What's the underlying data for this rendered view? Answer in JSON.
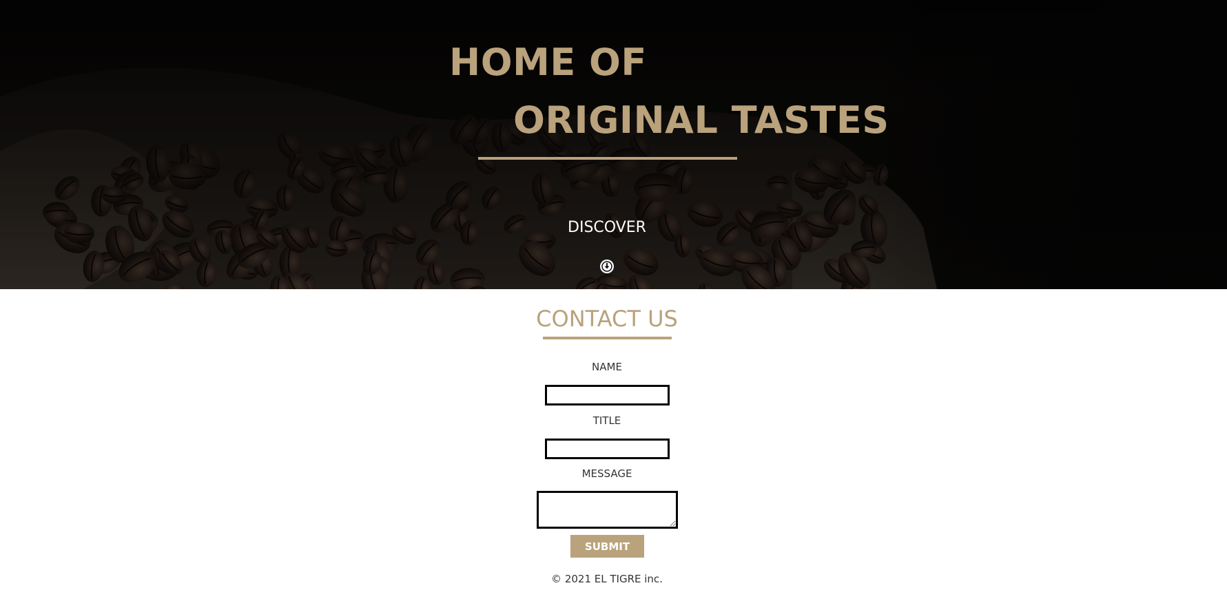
{
  "hero": {
    "title_line1": "HOME OF",
    "title_line2": "ORIGINAL TASTES",
    "discover_label": "DISCOVER",
    "discover_icon": "arrow-circle-down-icon",
    "background": "coffee-beans-on-burlap"
  },
  "contact": {
    "title": "CONTACT US",
    "name_label": "NAME",
    "name_value": "",
    "title_label": "TITLE",
    "title_value": "",
    "message_label": "MESSAGE",
    "message_value": "",
    "submit_label": "SUBMIT"
  },
  "footer": {
    "copyright": "© 2021 EL TIGRE inc."
  },
  "colors": {
    "accent": "#b9a27c",
    "hero_bg": "#0a0908",
    "text": "#333333",
    "white": "#ffffff"
  }
}
